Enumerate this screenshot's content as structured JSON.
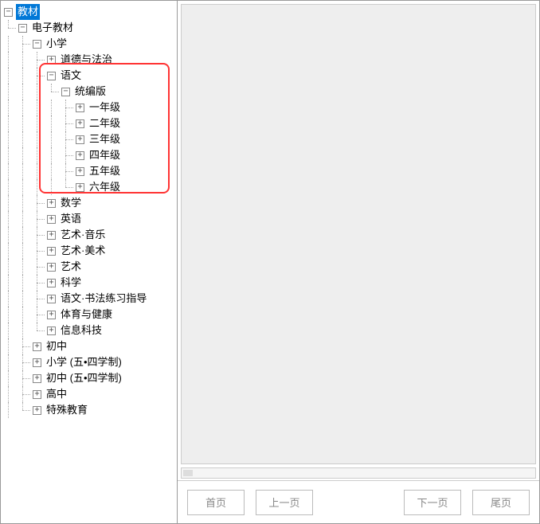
{
  "tree": {
    "root": {
      "label": "教材",
      "toggle": "minus",
      "selected": true
    },
    "ebook": {
      "label": "电子教材",
      "toggle": "minus"
    },
    "primary": {
      "label": "小学",
      "toggle": "minus"
    },
    "subjects_before": [
      {
        "label": "道德与法治",
        "toggle": "plus"
      }
    ],
    "chinese": {
      "label": "语文",
      "toggle": "minus"
    },
    "chinese_edition": {
      "label": "统编版",
      "toggle": "minus"
    },
    "grades": [
      {
        "label": "一年级",
        "toggle": "plus"
      },
      {
        "label": "二年级",
        "toggle": "plus"
      },
      {
        "label": "三年级",
        "toggle": "plus"
      },
      {
        "label": "四年级",
        "toggle": "plus"
      },
      {
        "label": "五年级",
        "toggle": "plus"
      },
      {
        "label": "六年级",
        "toggle": "plus"
      }
    ],
    "subjects_after": [
      {
        "label": "数学",
        "toggle": "plus"
      },
      {
        "label": "英语",
        "toggle": "plus"
      },
      {
        "label": "艺术·音乐",
        "toggle": "plus"
      },
      {
        "label": "艺术·美术",
        "toggle": "plus"
      },
      {
        "label": "艺术",
        "toggle": "plus"
      },
      {
        "label": "科学",
        "toggle": "plus"
      },
      {
        "label": "语文·书法练习指导",
        "toggle": "plus"
      },
      {
        "label": "体育与健康",
        "toggle": "plus"
      },
      {
        "label": "信息科技",
        "toggle": "plus"
      }
    ],
    "stages_after": [
      {
        "label": "初中",
        "toggle": "plus"
      },
      {
        "label": "小学 (五•四学制)",
        "toggle": "plus"
      },
      {
        "label": "初中 (五•四学制)",
        "toggle": "plus"
      },
      {
        "label": "高中",
        "toggle": "plus"
      },
      {
        "label": "特殊教育",
        "toggle": "plus"
      }
    ]
  },
  "pagination": {
    "first": "首页",
    "prev": "上一页",
    "next": "下一页",
    "last": "尾页"
  }
}
